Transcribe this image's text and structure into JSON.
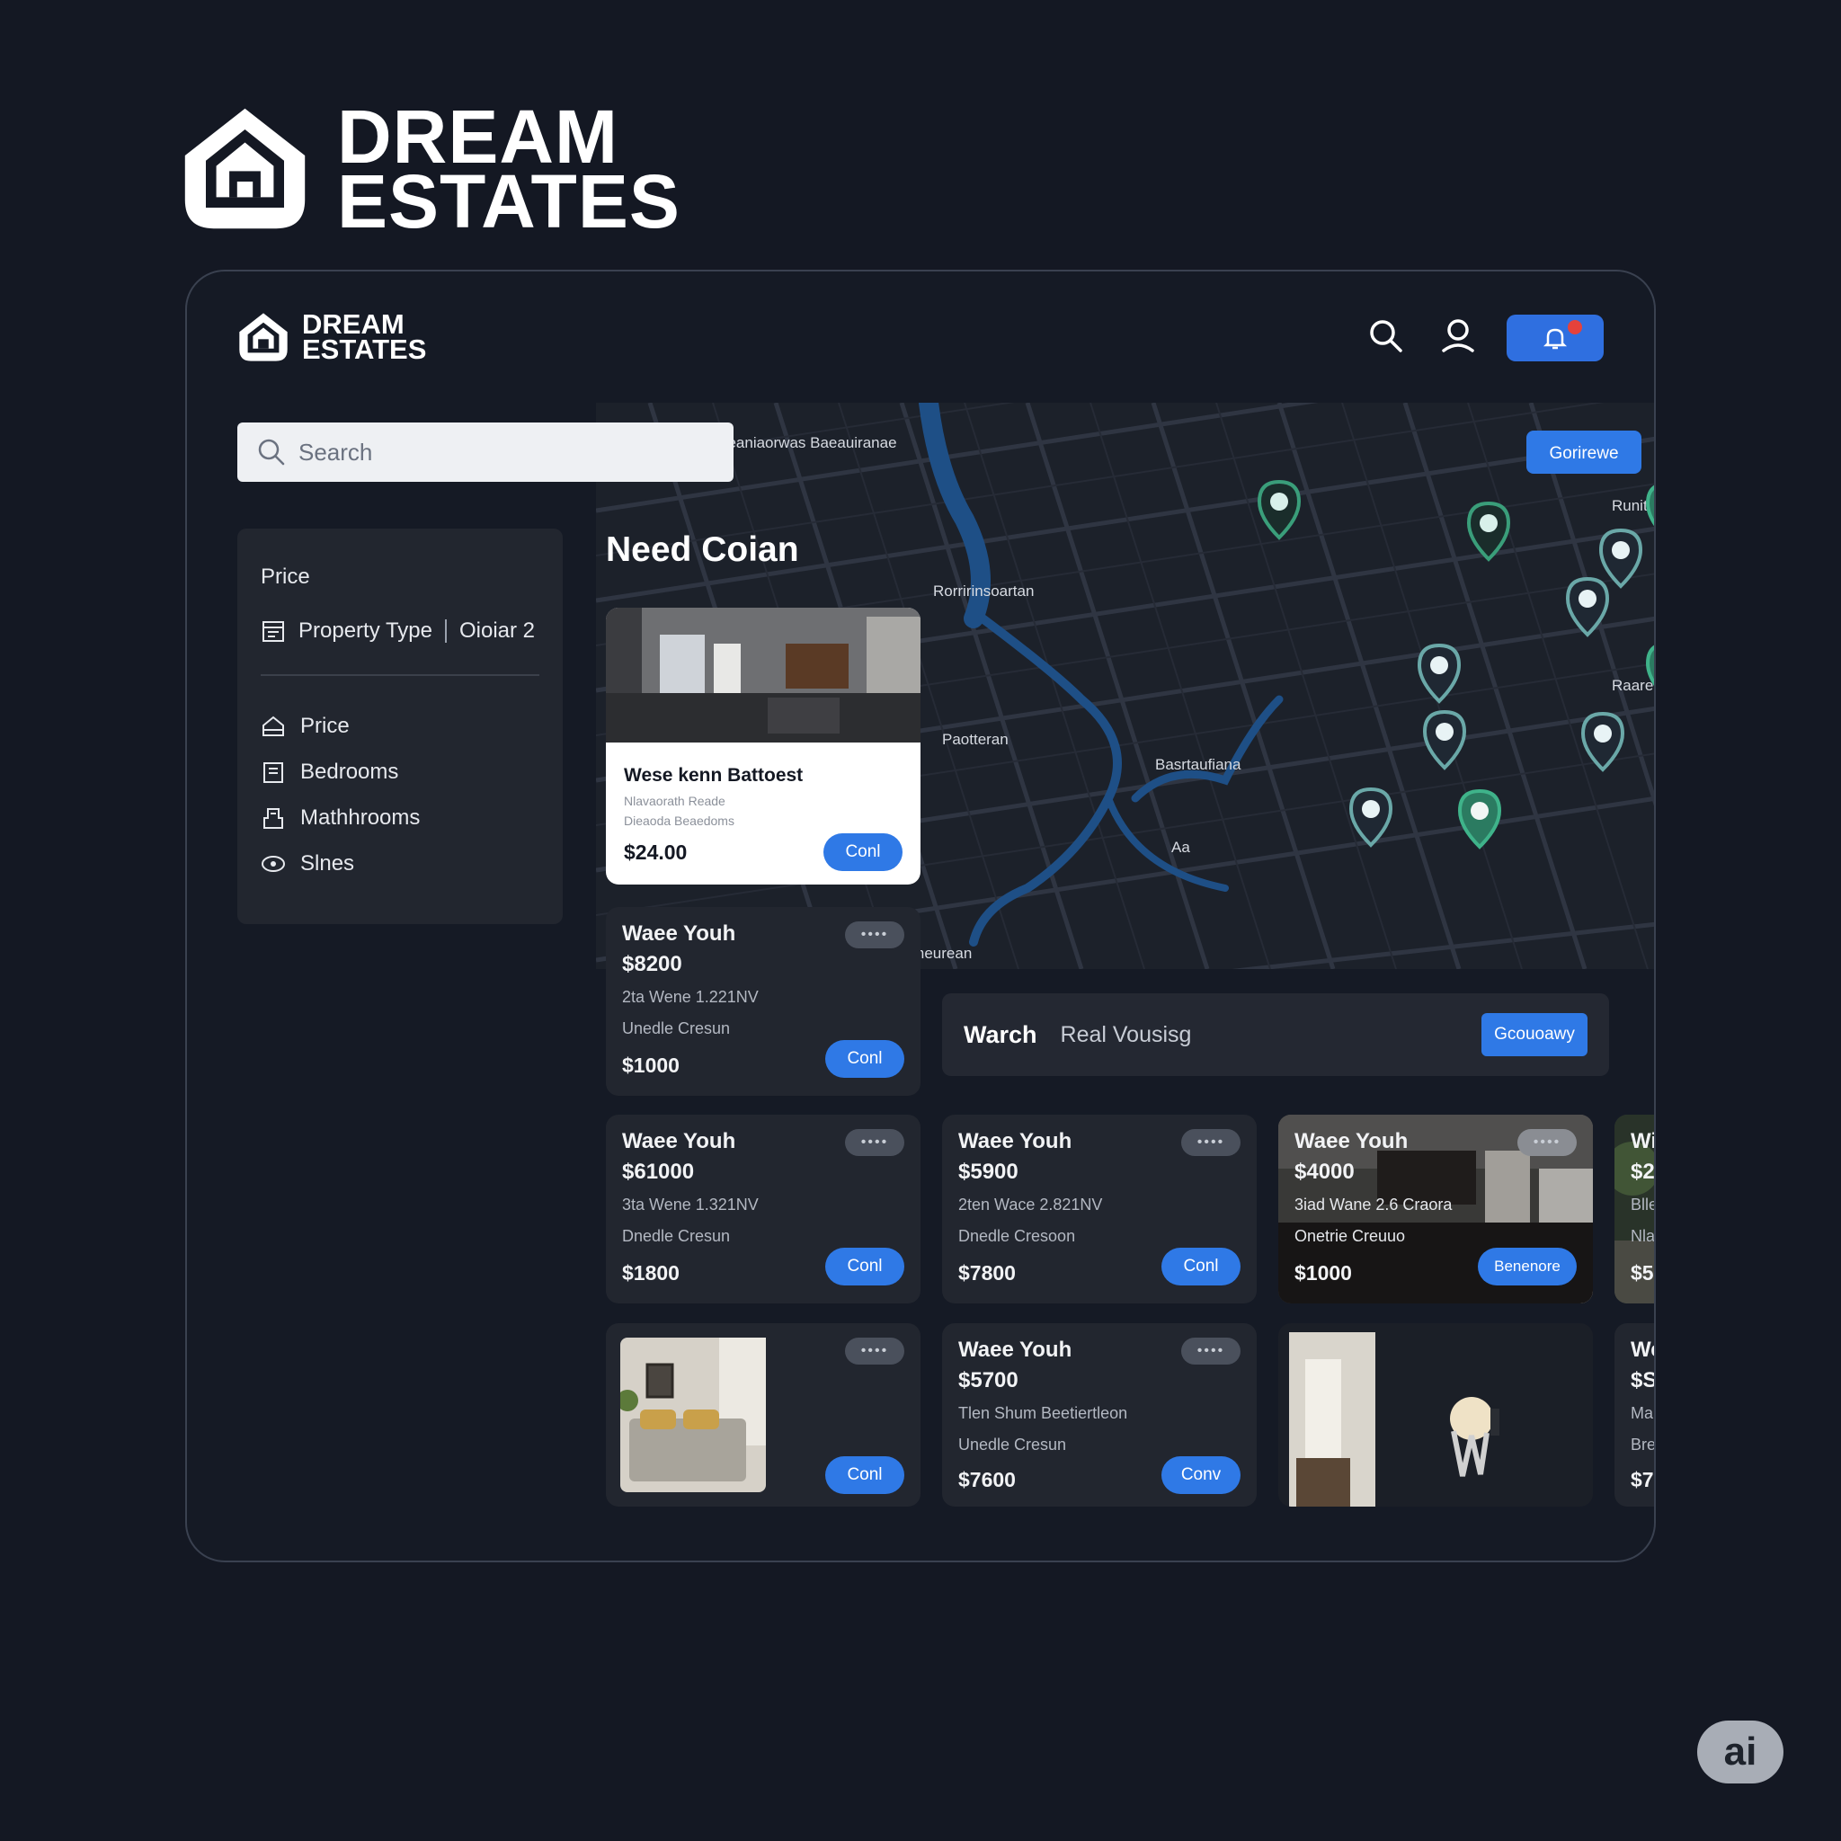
{
  "brand": {
    "line1": "DREAM",
    "line2": "ESTATES"
  },
  "header": {
    "logo_line1": "DREAM",
    "logo_line2": "ESTATES"
  },
  "search": {
    "placeholder": "Search"
  },
  "filters": {
    "price_label": "Price",
    "property_type": "Property Type",
    "property_value": "Oioiar 2",
    "items": [
      {
        "icon": "home-icon",
        "label": "Price"
      },
      {
        "icon": "bed-icon",
        "label": "Bedrooms"
      },
      {
        "icon": "bath-icon",
        "label": "Mathhrooms"
      },
      {
        "icon": "eye-icon",
        "label": "Slnes"
      }
    ]
  },
  "map": {
    "button": "Gorirewe",
    "labels": [
      "Boreaniaorwas Baeauiranae",
      "Rorririnsoartan",
      "Paotteran",
      "Basrtaufiana",
      "Roumeurean",
      "Runitsu",
      "Raareaiia",
      "Aa"
    ]
  },
  "section_title": "Need Coian",
  "featured": {
    "title": "Wese kenn Battoest",
    "sub1": "Nlavaorath Reade",
    "sub2": "Dieaoda Beaedoms",
    "price": "$24.00",
    "button": "Conl"
  },
  "warch": {
    "title": "Warch",
    "subtitle": "Real Vousisg",
    "button": "Gcouoawy"
  },
  "listings": [
    {
      "title": "Waee Youh",
      "price": "$8200",
      "line1": "2ta Wene 1.221NV",
      "line2": "Unedle Cresun",
      "amount": "$1000",
      "button": "Conl"
    },
    {
      "title": "Waee Youh",
      "price": "$61000",
      "line1": "3ta Wene 1.321NV",
      "line2": "Dnedle Cresun",
      "amount": "$1800",
      "button": "Conl"
    },
    {
      "title": "Waee Youh",
      "price": "$5900",
      "line1": "2ten Wace 2.821NV",
      "line2": "Dnedle Cresoon",
      "amount": "$7800",
      "button": "Conl"
    },
    {
      "title": "Waee Youh",
      "price": "$4000",
      "line1": "3iad Wane 2.6 Craora",
      "line2": "Onetrie Creuuo",
      "amount": "$1000",
      "button": "Benenore"
    },
    {
      "title": "Wi",
      "price": "$2",
      "line1": "Blle",
      "line2": "Nla",
      "amount": "$5"
    },
    {
      "title": "",
      "price": "",
      "button": "Conl"
    },
    {
      "title": "Waee Youh",
      "price": "$5700",
      "line1": "Tlen Shum Beetiertleon",
      "line2": "Unedle Cresun",
      "amount": "$7600",
      "button": "Conv"
    },
    {
      "title": "We",
      "price": "$S",
      "line1": "Ma",
      "line2": "Bre",
      "amount": "$7"
    }
  ],
  "pill_dots": "••••",
  "ai_badge": "ai",
  "colors": {
    "accent": "#2f79e6",
    "background": "#141823",
    "card": "#22262f",
    "pin": "#3a9e7a",
    "notification": "#e5423b"
  }
}
